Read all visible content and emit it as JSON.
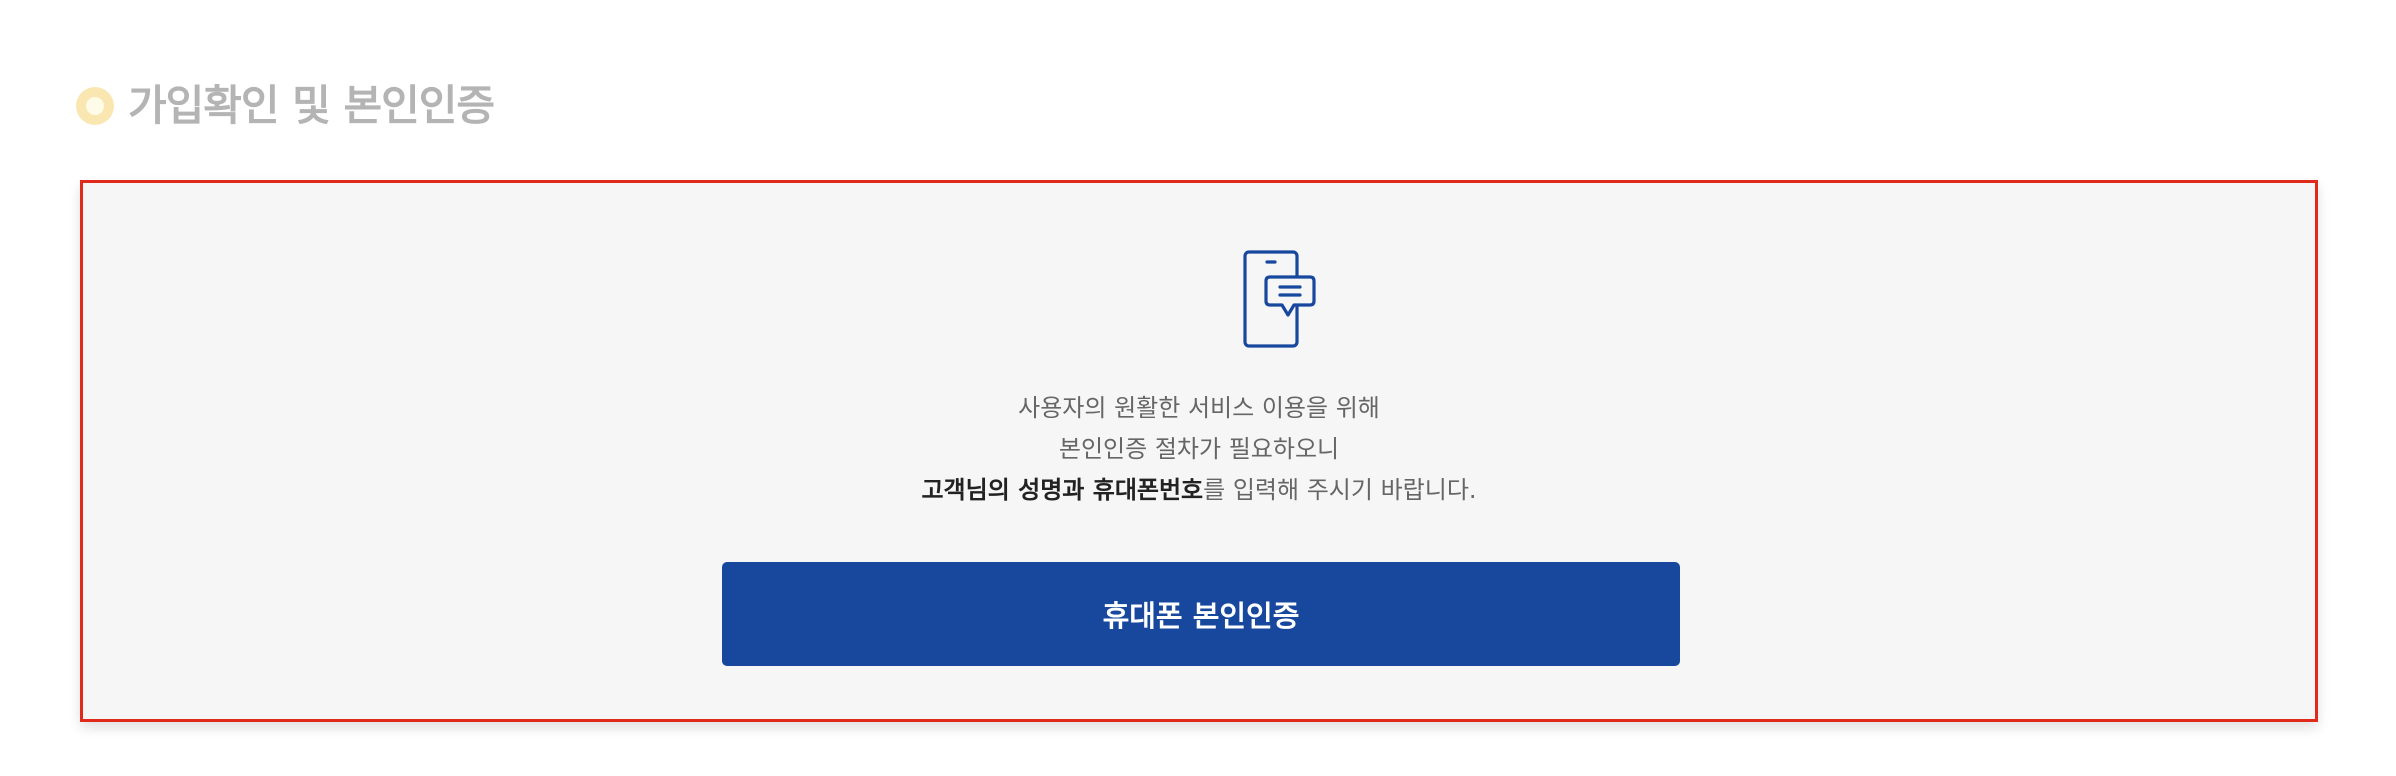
{
  "section": {
    "title": "가입확인 및 본인인증",
    "icon": "ring-bullet-icon"
  },
  "auth_box": {
    "icon": "mobile-message-icon",
    "description": {
      "line1": "사용자의 원활한 서비스 이용을 위해",
      "line2": "본인인증 절차가 필요하오니",
      "line3_bold1": "고객님의 성명",
      "line3_mid": "과 ",
      "line3_bold2": "휴대폰번호",
      "line3_rest": "를 입력해 주시기 바랍니다."
    },
    "button_label": "휴대폰 본인인증"
  },
  "colors": {
    "accent": "#17489e",
    "highlight_border": "#e02a1b",
    "title_text": "#b4b4b4",
    "bullet": "#fae6b0",
    "box_background": "#f6f6f6"
  }
}
